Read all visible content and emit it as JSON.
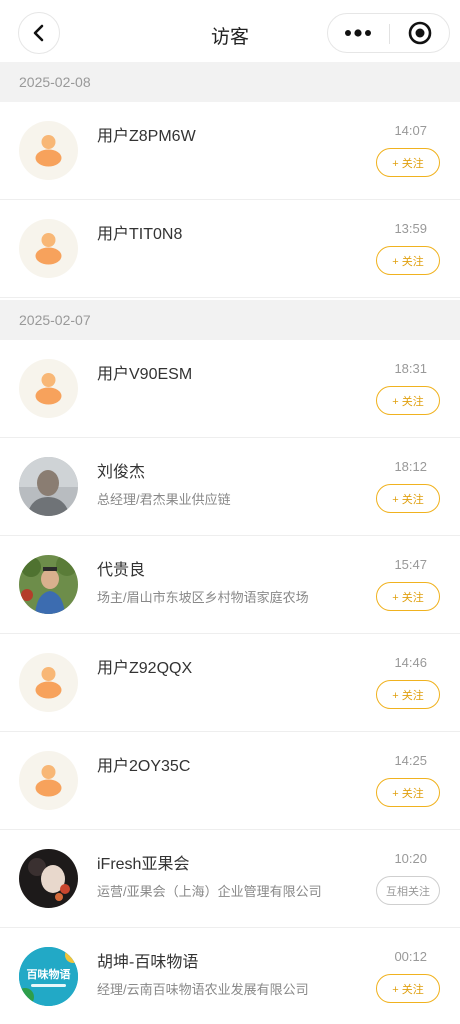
{
  "nav": {
    "title": "访客"
  },
  "colors": {
    "accent": "#f0b21f",
    "avatar_placeholder": "#f7a25c",
    "section_bg": "#f2f2f2"
  },
  "groups": [
    {
      "date": "2025-02-08",
      "visitors": [
        {
          "name": "用户Z8PM6W",
          "subtitle": "",
          "time": "14:07",
          "follow_label": "+ 关注",
          "avatar": "placeholder"
        },
        {
          "name": "用户TIT0N8",
          "subtitle": "",
          "time": "13:59",
          "follow_label": "+ 关注",
          "avatar": "placeholder"
        }
      ]
    },
    {
      "date": "2025-02-07",
      "visitors": [
        {
          "name": "用户V90ESM",
          "subtitle": "",
          "time": "18:31",
          "follow_label": "+ 关注",
          "avatar": "placeholder"
        },
        {
          "name": "刘俊杰",
          "subtitle": "总经理/君杰果业供应链",
          "time": "18:12",
          "follow_label": "+ 关注",
          "avatar": "photo-man-gray"
        },
        {
          "name": "代贵良",
          "subtitle": "场主/眉山市东坡区乡村物语家庭农场",
          "time": "15:47",
          "follow_label": "+ 关注",
          "avatar": "photo-orchard"
        },
        {
          "name": "用户Z92QQX",
          "subtitle": "",
          "time": "14:46",
          "follow_label": "+ 关注",
          "avatar": "placeholder"
        },
        {
          "name": "用户2OY35C",
          "subtitle": "",
          "time": "14:25",
          "follow_label": "+ 关注",
          "avatar": "placeholder"
        },
        {
          "name": "iFresh亚果会",
          "subtitle": "运营/亚果会（上海）企业管理有限公司",
          "time": "10:20",
          "follow_label": "互相关注",
          "avatar": "photo-dark"
        },
        {
          "name": "胡坤-百味物语",
          "subtitle": "经理/云南百味物语农业发展有限公司",
          "time": "00:12",
          "follow_label": "+ 关注",
          "avatar": "logo-baiwei"
        }
      ]
    }
  ],
  "logo_text": "百味物语"
}
